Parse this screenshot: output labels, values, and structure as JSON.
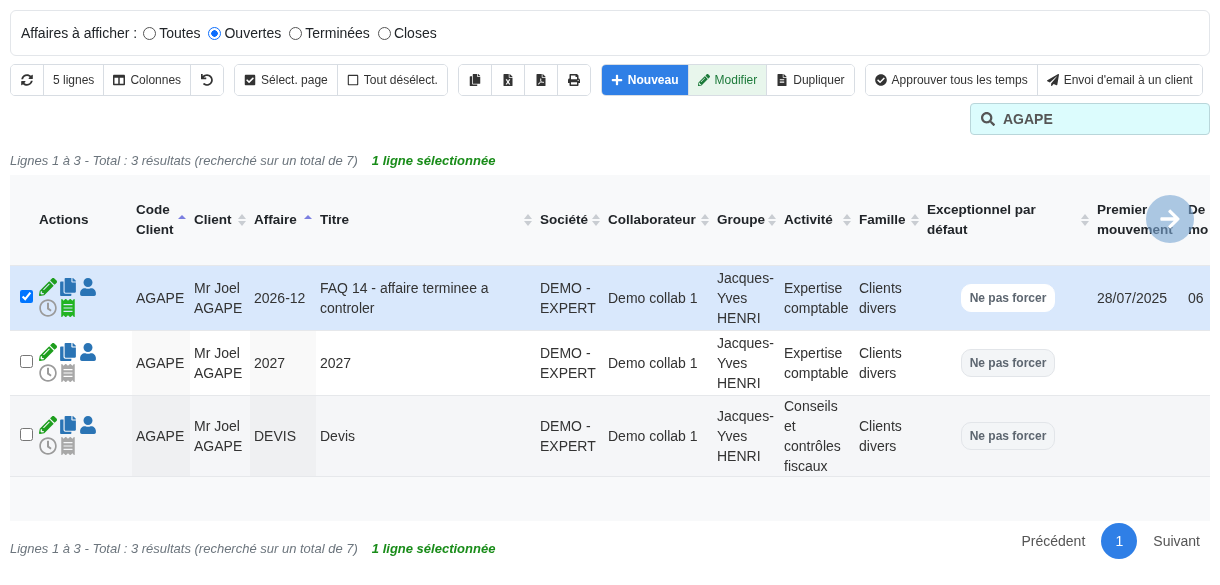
{
  "filter": {
    "label": "Affaires à afficher :",
    "options": [
      {
        "label": "Toutes",
        "selected": false
      },
      {
        "label": "Ouvertes",
        "selected": true
      },
      {
        "label": "Terminées",
        "selected": false
      },
      {
        "label": "Closes",
        "selected": false
      }
    ]
  },
  "toolbar": [
    {
      "buttons": [
        {
          "kind": "icon"
        },
        {
          "kind": "text",
          "label": "5 lignes"
        },
        {
          "kind": "text",
          "label": "Colonnes"
        },
        {
          "kind": "icon"
        }
      ]
    },
    {
      "buttons": [
        {
          "kind": "text",
          "label": "Sélect. page"
        },
        {
          "kind": "text",
          "label": "Tout désélect."
        }
      ]
    },
    {
      "buttons": [
        {
          "kind": "icon"
        },
        {
          "kind": "icon"
        },
        {
          "kind": "icon"
        },
        {
          "kind": "icon"
        }
      ]
    },
    {
      "buttons": [
        {
          "kind": "primary",
          "label": "Nouveau"
        },
        {
          "kind": "success",
          "label": "Modifier"
        },
        {
          "kind": "text",
          "label": "Dupliquer"
        }
      ]
    },
    {
      "buttons": [
        {
          "kind": "text",
          "label": "Approuver tous les temps"
        },
        {
          "kind": "text",
          "label": "Envoi d'email à un client"
        }
      ]
    }
  ],
  "search": {
    "value": "AGAPE"
  },
  "summary_top": {
    "text": "Lignes 1 à 3 - Total : 3 résultats (recherché sur un total de 7)",
    "selection": "1 ligne sélectionnée"
  },
  "table": {
    "actions_header": "Actions",
    "columns": [
      {
        "label": "Code Client",
        "sortable": true,
        "sorted": true
      },
      {
        "label": "Client",
        "sortable": true,
        "sorted": false
      },
      {
        "label": "Affaire",
        "sortable": true,
        "sorted": true
      },
      {
        "label": "Titre",
        "sortable": true,
        "sorted": false
      },
      {
        "label": "Société",
        "sortable": true,
        "sorted": false
      },
      {
        "label": "Collaborateur",
        "sortable": true,
        "sorted": false
      },
      {
        "label": "Groupe",
        "sortable": true,
        "sorted": false
      },
      {
        "label": "Activité",
        "sortable": true,
        "sorted": false
      },
      {
        "label": "Famille",
        "sortable": true,
        "sorted": false
      },
      {
        "label": "Exceptionnel par défaut",
        "sortable": true,
        "sorted": false
      },
      {
        "label": "Premier mouvement",
        "sortable": false,
        "sorted": false
      },
      {
        "label": "De mo",
        "sortable": false,
        "sorted": false
      }
    ],
    "rows": [
      {
        "selected": true,
        "invoice_active": true,
        "cells": [
          "AGAPE",
          "Mr Joel AGAPE",
          "2026-12",
          "FAQ 14 - affaire terminee a controler",
          "DEMO - EXPERT",
          "Demo collab 1",
          "Jacques-Yves HENRI",
          "Expertise comptable",
          "Clients divers",
          "Ne pas forcer",
          "28/07/2025",
          "06"
        ]
      },
      {
        "selected": false,
        "invoice_active": false,
        "cells": [
          "AGAPE",
          "Mr Joel AGAPE",
          "2027",
          "2027",
          "DEMO - EXPERT",
          "Demo collab 1",
          "Jacques-Yves HENRI",
          "Expertise comptable",
          "Clients divers",
          "Ne pas forcer",
          null,
          null
        ]
      },
      {
        "selected": false,
        "invoice_active": false,
        "cells": [
          "AGAPE",
          "Mr Joel AGAPE",
          "DEVIS",
          "Devis",
          "DEMO - EXPERT",
          "Demo collab 1",
          "Jacques-Yves HENRI",
          "Conseils et contrôles fiscaux",
          "Clients divers",
          "Ne pas forcer",
          null,
          null
        ]
      }
    ]
  },
  "summary_bottom": {
    "text": "Lignes 1 à 3 - Total : 3 résultats (recherché sur un total de 7)",
    "selection": "1 ligne sélectionnée"
  },
  "pagination": {
    "previous": "Précédent",
    "pages": [
      {
        "label": "1",
        "selected": true
      }
    ],
    "next": "Suivant"
  }
}
